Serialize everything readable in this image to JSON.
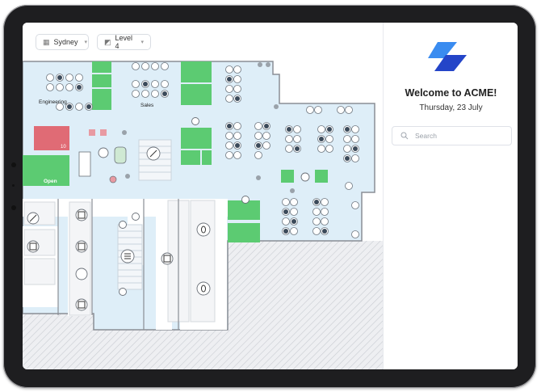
{
  "location_dropdown": {
    "value": "Sydney",
    "icon": "building-icon"
  },
  "level_dropdown": {
    "value": "Level 4",
    "icon": "floor-icon"
  },
  "map": {
    "area_labels": {
      "engineering": "Engineering",
      "sales": "Sales"
    },
    "room_status": {
      "count": "10",
      "status": "Open"
    },
    "colors": {
      "floor": "#deeef8",
      "desk_booked": "#5ccb72",
      "room_busy": "#e06b75",
      "wall": "#8a8e95",
      "hatch": "#cfd2d8"
    }
  },
  "panel": {
    "welcome": "Welcome to ACME!",
    "date": "Thursday, 23 July",
    "search_placeholder": "Search",
    "brand_color": "#2a62e6"
  }
}
